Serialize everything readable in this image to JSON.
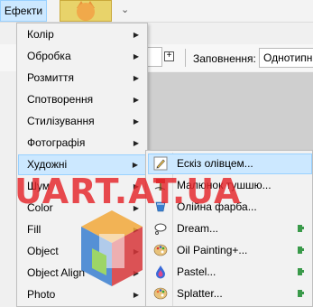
{
  "menubar": {
    "effects_label": "Ефекти"
  },
  "toolbar": {
    "fill_label": "Заповнення:",
    "fill_value": "Однотипн"
  },
  "effects_menu": {
    "items": [
      {
        "label": "Колір",
        "has_submenu": true
      },
      {
        "label": "Обробка",
        "has_submenu": true
      },
      {
        "label": "Розмиття",
        "has_submenu": true
      },
      {
        "label": "Спотворення",
        "has_submenu": true
      },
      {
        "label": "Стилізування",
        "has_submenu": true
      },
      {
        "label": "Фотографія",
        "has_submenu": true
      },
      {
        "label": "Художні",
        "has_submenu": true,
        "highlighted": true
      },
      {
        "label": "Шум",
        "has_submenu": true
      },
      {
        "label": "Color",
        "has_submenu": true
      },
      {
        "label": "Fill",
        "has_submenu": true
      },
      {
        "label": "Object",
        "has_submenu": true
      },
      {
        "label": "Object Align",
        "has_submenu": true
      },
      {
        "label": "Photo",
        "has_submenu": true
      }
    ]
  },
  "artistic_submenu": {
    "items": [
      {
        "label": "Ескіз олівцем...",
        "icon": "pencil-sketch-icon",
        "highlighted": true,
        "plugin": false
      },
      {
        "label": "Малюнок тушшю...",
        "icon": "ink-sketch-icon",
        "plugin": false
      },
      {
        "label": "Олійна фарба...",
        "icon": "oil-paint-icon",
        "plugin": false
      },
      {
        "label": "Dream...",
        "icon": "dream-cloud-icon",
        "plugin": true
      },
      {
        "label": "Oil Painting+...",
        "icon": "palette-icon",
        "plugin": true
      },
      {
        "label": "Pastel...",
        "icon": "pastel-drop-icon",
        "plugin": true
      },
      {
        "label": "Splatter...",
        "icon": "splatter-palette-icon",
        "plugin": true
      }
    ]
  },
  "watermark": {
    "text": "UART.AT.UA"
  },
  "colors": {
    "highlight": "#cce8ff",
    "highlight_border": "#99d1ff",
    "plugin_icon": "#3a9a4a",
    "watermark": "#e5252a"
  }
}
